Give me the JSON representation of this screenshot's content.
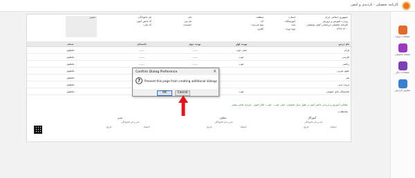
{
  "topbar": {
    "title": "کارنامه تحصیلی - بازدیدی و کیفی",
    "logo_icon": "org-seal-icon"
  },
  "sidebar": {
    "items": [
      {
        "label": "صفحات دوازه",
        "icon": "home-icon",
        "color": "#e06a2c"
      },
      {
        "label": "صفحه تحصیلی",
        "icon": "books-icon",
        "color": "#9a3bbf"
      },
      {
        "label": "صفحات دیگر",
        "icon": "grid-icon",
        "color": "#7c3fb8"
      },
      {
        "label": "تصاویر گزارش",
        "icon": "report-icon",
        "color": "#3a7fcf"
      }
    ]
  },
  "header": {
    "gov_lines": [
      "جمهوری اسلامی ایران",
      "وزارت آموزش و پرورش",
      "کارنامه تحصیلی ارزشیابی کیفی توصیفی",
      "۱۳۹۹-۱۴۰۰"
    ],
    "region_lines": [
      "استان:",
      "آموزشگاه:",
      "پایه:",
      "نوع دوره:"
    ],
    "period_lines": [
      "منطقه:",
      "کد:",
      "نوع مدرسه:",
      "کلاس:"
    ],
    "student_lines": [
      "نام:",
      "نام پدر:",
      "جنسیت:"
    ],
    "student_lines2": [
      "نام خانوادگی:",
      "کد دانش آموز:",
      "کد ملی:"
    ],
    "photo_label": "تصویر"
  },
  "table": {
    "columns": [
      "نام درس",
      "نوبت اول",
      "نوبت دوم",
      "تابستان",
      "نتیجه"
    ],
    "rows": [
      {
        "name": "قرآن",
        "t1": "خیلی خوب",
        "t2": "------",
        "ex": "------",
        "res": "نامعلوم"
      },
      {
        "name": "فارسی",
        "t1": "خوب",
        "t2": "------",
        "ex": "------",
        "res": "نامعلوم"
      },
      {
        "name": "ریاضی",
        "t1": "خوب",
        "t2": "------",
        "ex": "------",
        "res": "نامعلوم"
      },
      {
        "name": "علوم تجربی",
        "t1": "",
        "t2": "",
        "ex": "",
        "res": "نامعلوم"
      },
      {
        "name": "هنر",
        "t1": "",
        "t2": "",
        "ex": "",
        "res": "نامعلوم"
      },
      {
        "name": "تربیت بدنی",
        "t1": "",
        "t2": "",
        "ex": "",
        "res": "نامعلوم"
      },
      {
        "name": "شایستگی های عمومی",
        "t1": "خوب",
        "t2": "------",
        "ex": "------",
        "res": "نامعلوم"
      }
    ]
  },
  "notes": {
    "line1": "عملکرد آموزش و ارزیابی دانش آموز در طول سال تحصیلی: خیلی خوب - خوب - قابل قبول - نیازمند تلاش بیشتر",
    "line2": "ملاحظات:"
  },
  "signatures": {
    "teacher": {
      "title": "آموزگار",
      "name_label": "نام و نام خانوادگی:",
      "date_label": "تاریخ:",
      "sign_label": "امضاء:"
    },
    "deputy": {
      "title": "معاون",
      "name_label": "نام و نام خانوادگی:",
      "date_label": "تاریخ:",
      "sign_label": "امضاء:"
    },
    "principal": {
      "title": "مدیر",
      "name_label": "نام و نام خانوادگی:",
      "date_label": "تاریخ:",
      "sign_label": "امضاء:"
    },
    "qr_icon": "qr-code-icon"
  },
  "dialog": {
    "title": "Confirm Dialog Preference",
    "close_glyph": "×",
    "message": "Prevent this page from creating additional dialogs",
    "ok_label": "OK",
    "cancel_label": "Cancel",
    "icon": "question-icon"
  },
  "annotation": {
    "arrow_icon": "red-arrow-up-icon",
    "color": "#e0141c"
  }
}
